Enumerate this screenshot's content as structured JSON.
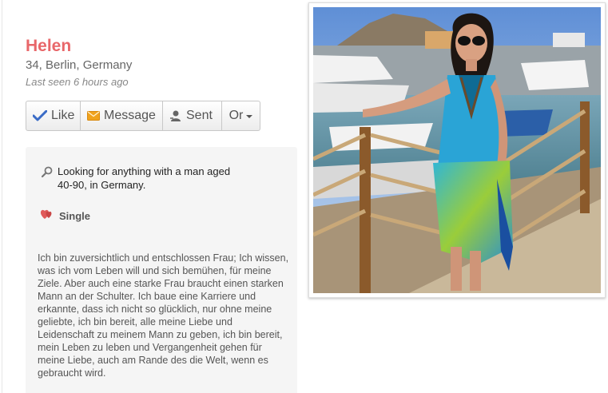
{
  "profile": {
    "name": "Helen",
    "location": "34, Berlin, Germany",
    "last_seen": "Last seen 6 hours ago"
  },
  "actions": {
    "like": "Like",
    "message": "Message",
    "sent": "Sent",
    "more": "Or"
  },
  "details": {
    "looking_for": "Looking for anything with a man aged 40-90, in Germany.",
    "status": "Single",
    "bio": "Ich bin zuversichtlich und entschlossen Frau; Ich wissen, was ich vom Leben will und sich bemühen, für meine Ziele. Aber auch eine starke Frau braucht einen starken Mann an der Schulter. Ich baue eine Karriere und erkannte, dass ich nicht so glücklich, nur ohne meine geliebte, ich bin bereit, alle meine Liebe und Leidenschaft zu meinem Mann zu geben, ich bin bereit, mein Leben zu leben und Vergangenheit gehen für meine Liebe, auch am Rande des die Welt, wenn es gebraucht wird."
  },
  "colors": {
    "name_accent": "#e8676a",
    "like_check": "#3b6cc6",
    "message_envelope": "#f0a21c",
    "heart": "#e05a5a"
  },
  "icons": {
    "like": "checkmark-icon",
    "message": "envelope-icon",
    "sent": "user-sent-icon",
    "looking": "search-icon",
    "status": "hearts-icon"
  }
}
